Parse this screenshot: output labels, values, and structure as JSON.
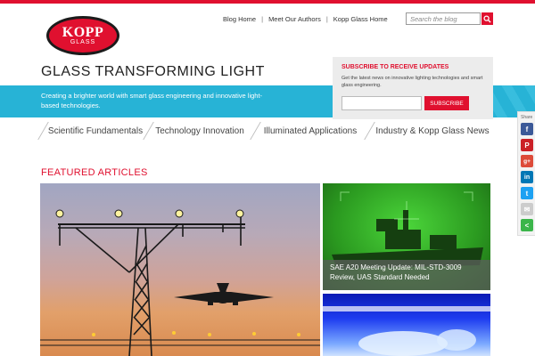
{
  "brand": {
    "logo_top": "KOPP",
    "logo_bottom": "GLASS",
    "accent": "#e0102f"
  },
  "topnav": {
    "items": [
      "Blog Home",
      "Meet Our Authors",
      "Kopp Glass Home"
    ],
    "separator": "|"
  },
  "search": {
    "placeholder": "Search the blog",
    "icon": "search-icon"
  },
  "site_title": "GLASS TRANSFORMING LIGHT",
  "tagline": "Creating a brighter world with smart glass engineering and innovative light-based technologies.",
  "subscribe": {
    "heading": "SUBSCRIBE TO RECEIVE UPDATES",
    "description": "Get the latest news on innovative lighting technologies and smart glass engineering.",
    "button": "SUBSCRIBE"
  },
  "categories": [
    "Scientific Fundamentals",
    "Technology Innovation",
    "Illuminated Applications",
    "Industry & Kopp Glass News"
  ],
  "featured_heading": "FEATURED ARTICLES",
  "articles": [
    {
      "caption": "",
      "image": "airport-approach-lights-plane"
    },
    {
      "caption": "SAE A20 Meeting Update: MIL-STD-3009 Review, UAS Standard Needed",
      "image": "night-vision-warship"
    },
    {
      "caption": "",
      "image": "blue-lit-equipment"
    }
  ],
  "share": {
    "label": "Share",
    "buttons": [
      {
        "name": "facebook-icon",
        "color": "#3b5998",
        "glyph": "f"
      },
      {
        "name": "pinterest-icon",
        "color": "#cb2027",
        "glyph": "P"
      },
      {
        "name": "google-plus-icon",
        "color": "#dd4b39",
        "glyph": "g+"
      },
      {
        "name": "linkedin-icon",
        "color": "#0077b5",
        "glyph": "in"
      },
      {
        "name": "twitter-icon",
        "color": "#1da1f2",
        "glyph": "t"
      },
      {
        "name": "email-icon",
        "color": "#cccccc",
        "glyph": "✉"
      },
      {
        "name": "sharethis-icon",
        "color": "#3bb54a",
        "glyph": "<"
      }
    ]
  }
}
